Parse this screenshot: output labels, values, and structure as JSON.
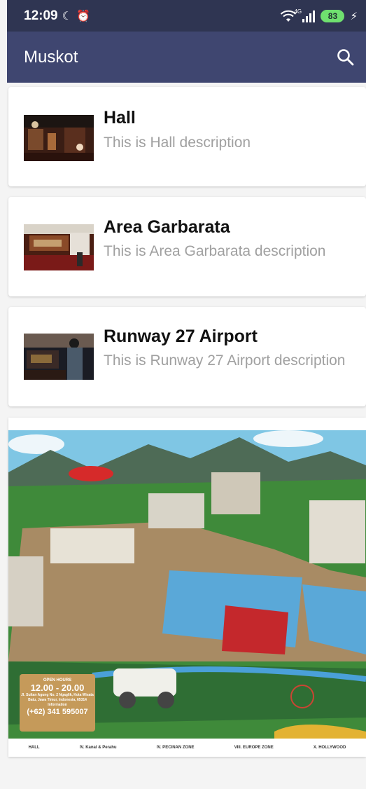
{
  "status_bar": {
    "time": "12:09",
    "network_tag": "4G",
    "battery": "83",
    "icons": [
      "moon-icon",
      "alarm-icon",
      "wifi-icon",
      "signal-icon",
      "battery-icon",
      "charging-icon"
    ]
  },
  "app_bar": {
    "title": "Muskot",
    "search_icon": "search-icon"
  },
  "items": [
    {
      "title": "Hall",
      "description": "This is Hall description"
    },
    {
      "title": "Area Garbarata",
      "description": "This is Area Garbarata description"
    },
    {
      "title": "Runway 27 Airport",
      "description": "This is Runway 27 Airport description"
    }
  ],
  "map": {
    "open_hours_label": "OPEN HOURS",
    "open_hours": "12.00 - 20.00",
    "address": "Jl. Sultan Agung No. 2 Ngaglik, Kota Wisata Batu, Jawa Timur, Indonesia, 65314",
    "information_label": "Information",
    "phone": "(+62) 341 595007",
    "zone_labels": [
      "HALL",
      "IV. Kanal & Perahu",
      "IV. PECINAN ZONE",
      "VIII. EUROPE ZONE",
      "X. HOLLYWOOD"
    ]
  }
}
